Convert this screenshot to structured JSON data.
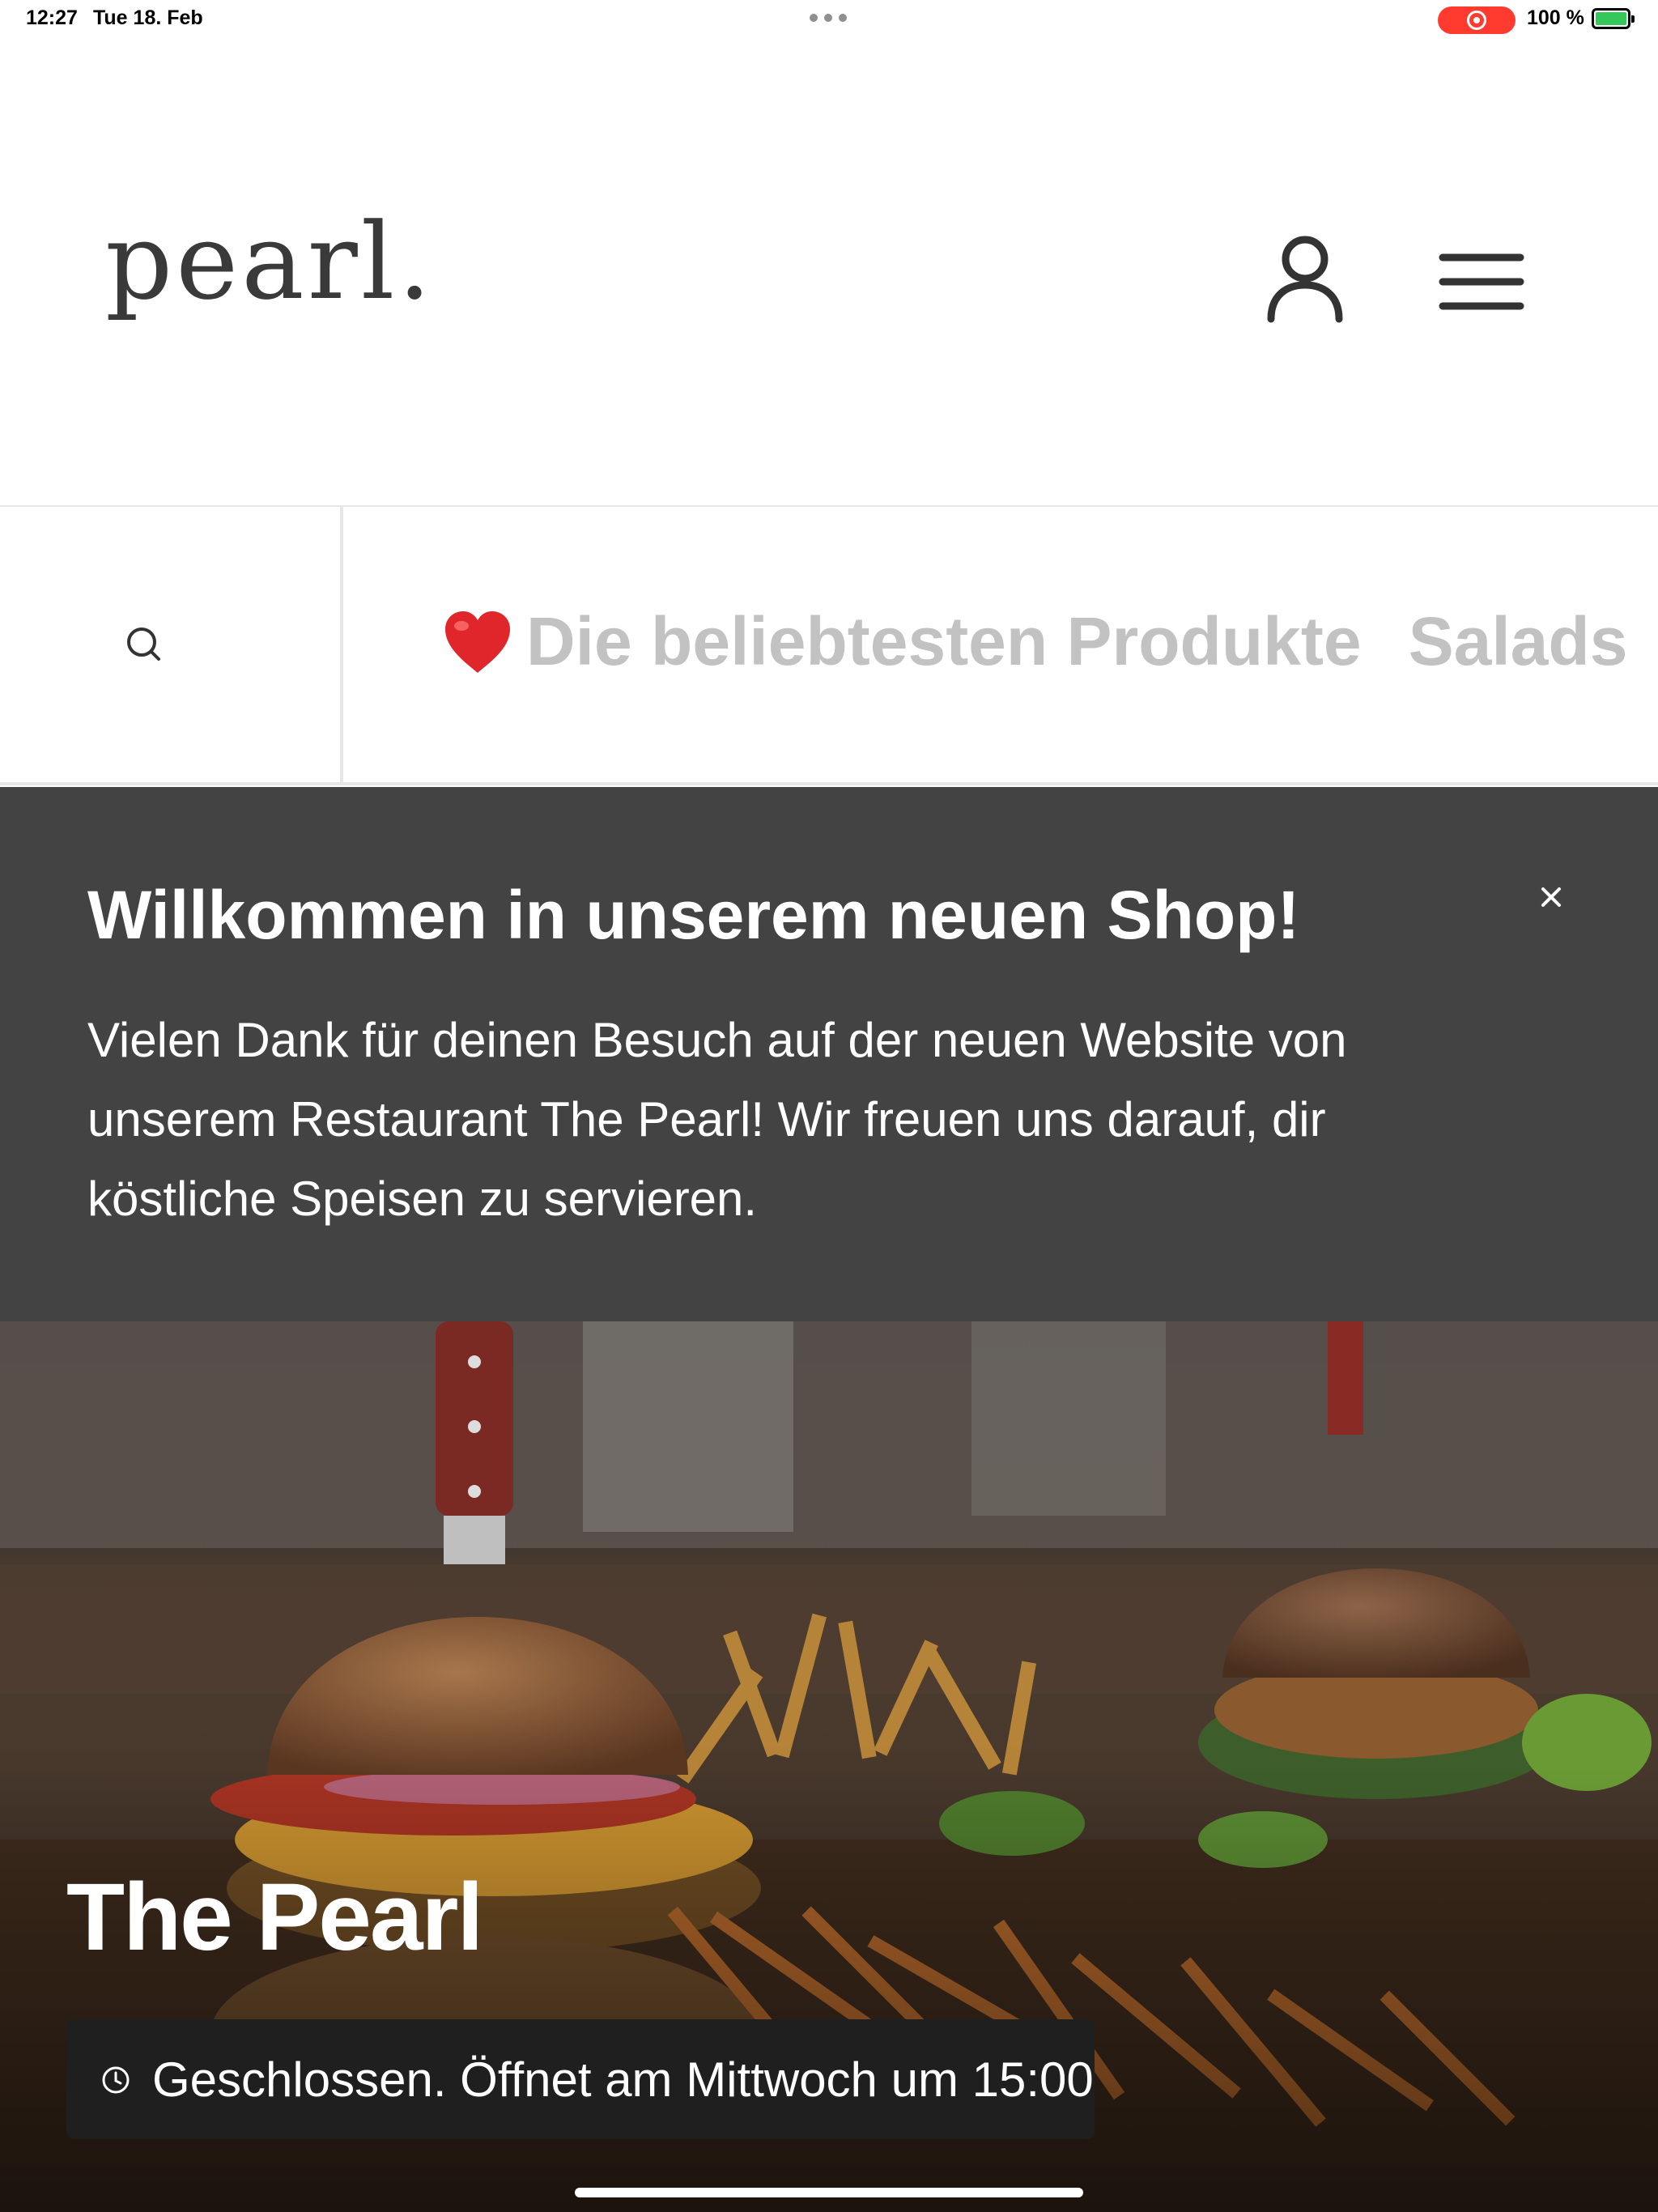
{
  "status_bar": {
    "time": "12:27",
    "date": "Tue 18. Feb",
    "battery": "100 %",
    "battery_level": 1.0
  },
  "header": {
    "logo": "pearl.",
    "user_icon": "user-icon",
    "menu_icon": "hamburger-menu-icon"
  },
  "categories": {
    "search_icon": "search-icon",
    "items": [
      {
        "label": "Die beliebtesten Produkte",
        "icon": "heart-icon"
      },
      {
        "label": "Salads"
      }
    ]
  },
  "banner": {
    "title": "Willkommen in unserem neuen Shop!",
    "text": "Vielen Dank für deinen Besuch auf der neuen Website von unserem Restaurant The Pearl! Wir freuen uns darauf, dir köstliche Speisen zu servieren.",
    "close_icon": "close-icon",
    "background": "#434343"
  },
  "hero": {
    "title": "The Pearl",
    "hours": "Geschlossen. Öffnet am Mittwoch um 15:00",
    "clock_icon": "clock-icon"
  }
}
